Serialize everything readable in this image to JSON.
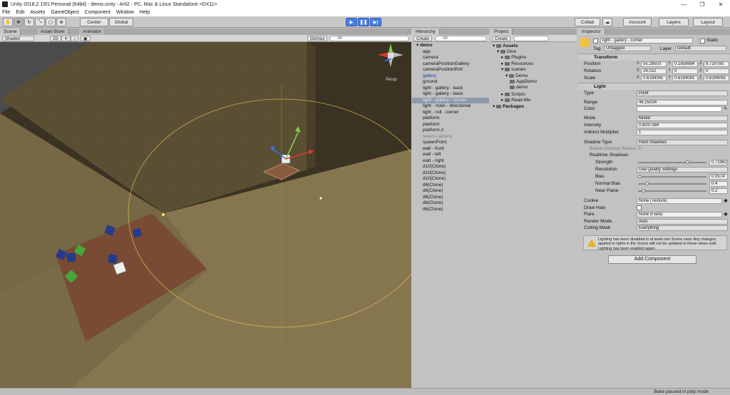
{
  "window": {
    "title": "Unity 2018.2.15f1 Personal (64bit) - demo.unity - Arti2 - PC, Mac & Linux Standalone <DX11>",
    "minimize": "—",
    "maximize": "❐",
    "close": "✕"
  },
  "menu": [
    "File",
    "Edit",
    "Assets",
    "GameObject",
    "Component",
    "Window",
    "Help"
  ],
  "toolbar": {
    "pivot": "Center",
    "space": "Global",
    "collab": "Collab",
    "account": "Account",
    "layers": "Layers",
    "layout": "Layout"
  },
  "tabs": {
    "scene": "Scene",
    "asset_store": "Asset Store",
    "animator": "Animator",
    "hierarchy": "Hierarchy",
    "project": "Project",
    "inspector": "Inspector"
  },
  "scene_bar": {
    "shading": "Shaded",
    "mode": "2D",
    "gizmos": "Gizmos",
    "search": "All"
  },
  "scene_view": {
    "persp": "Persp"
  },
  "hierarchy": {
    "create": "Create",
    "search": "All",
    "root": "demo",
    "items": [
      {
        "label": "app",
        "state": "normal"
      },
      {
        "label": "camera",
        "state": "normal"
      },
      {
        "label": "cameraPositionGallery",
        "state": "normal"
      },
      {
        "label": "cameraPositionRoll",
        "state": "normal"
      },
      {
        "label": "gallery",
        "state": "prefab"
      },
      {
        "label": "ground",
        "state": "normal"
      },
      {
        "label": "light - gallery - back",
        "state": "normal"
      },
      {
        "label": "light - gallery - back",
        "state": "normal"
      },
      {
        "label": "light - gallery - corner",
        "state": "selected"
      },
      {
        "label": "light - main - directional",
        "state": "normal"
      },
      {
        "label": "light - roll - corner",
        "state": "normal"
      },
      {
        "label": "platform",
        "state": "normal"
      },
      {
        "label": "platform",
        "state": "normal"
      },
      {
        "label": "platform-2",
        "state": "normal"
      },
      {
        "label": "select-camera",
        "state": "dim"
      },
      {
        "label": "spawnPoint",
        "state": "normal"
      },
      {
        "label": "wall - front",
        "state": "normal"
      },
      {
        "label": "wall - left",
        "state": "normal"
      },
      {
        "label": "wall - right",
        "state": "normal"
      },
      {
        "label": "d10(Clone)",
        "state": "normal"
      },
      {
        "label": "d10(Clone)",
        "state": "normal"
      },
      {
        "label": "d10(Clone)",
        "state": "normal"
      },
      {
        "label": "d6(Clone)",
        "state": "normal"
      },
      {
        "label": "d6(Clone)",
        "state": "normal"
      },
      {
        "label": "d6(Clone)",
        "state": "normal"
      },
      {
        "label": "d6(Clone)",
        "state": "normal"
      },
      {
        "label": "d6(Clone)",
        "state": "normal"
      }
    ]
  },
  "project": {
    "create": "Create",
    "tree": [
      {
        "label": "Assets",
        "level": 0,
        "bold": true
      },
      {
        "label": "Dice",
        "level": 1
      },
      {
        "label": "Plugins",
        "level": 2
      },
      {
        "label": "Resources",
        "level": 2
      },
      {
        "label": "scenes",
        "level": 2
      },
      {
        "label": "Demo",
        "level": 3
      },
      {
        "label": "AppDemo",
        "level": 4
      },
      {
        "label": "demo",
        "level": 4
      },
      {
        "label": "Scripts",
        "level": 2
      },
      {
        "label": "Read-Me-",
        "level": 2
      },
      {
        "label": "Packages",
        "level": 0,
        "bold": true
      }
    ]
  },
  "inspector": {
    "name": "light - gallery - corner",
    "static": "Static",
    "tag_label": "Tag",
    "tag": "Untagged",
    "layer_label": "Layer",
    "layer": "Default",
    "transform": {
      "title": "Transform",
      "position": {
        "label": "Position",
        "x": "55.28503",
        "y": "0.1859684",
        "z": "9.720785"
      },
      "rotation": {
        "label": "Rotation",
        "x": "24.012",
        "y": "0",
        "z": "0"
      },
      "scale": {
        "label": "Scale",
        "x": "0.6194091",
        "y": "0.6194091",
        "z": "0.6194091"
      }
    },
    "light": {
      "title": "Light",
      "type": {
        "label": "Type",
        "value": "Point"
      },
      "range": {
        "label": "Range",
        "value": "46.25034"
      },
      "color": {
        "label": "Color",
        "value": "#ffffff"
      },
      "mode": {
        "label": "Mode",
        "value": "Mixed"
      },
      "intensity": {
        "label": "Intensity",
        "value": "0.8037384"
      },
      "indirect": {
        "label": "Indirect Multiplier",
        "value": "1"
      },
      "shadow_type": {
        "label": "Shadow Type",
        "value": "Hard Shadows"
      },
      "baked_radius": {
        "label": "Baked Shadow Radius",
        "value": "0"
      },
      "realtime_shadows": "Realtime Shadows",
      "strength": {
        "label": "Strength",
        "value": "0.71962",
        "fraction": 0.72
      },
      "resolution": {
        "label": "Resolution",
        "value": "Use Quality Settings"
      },
      "bias": {
        "label": "Bias",
        "value": "0.0574",
        "fraction": 0.03
      },
      "normal_bias": {
        "label": "Normal Bias",
        "value": "0.4",
        "fraction": 0.13
      },
      "near_plane": {
        "label": "Near Plane",
        "value": "0.2",
        "fraction": 0.08
      },
      "cookie": {
        "label": "Cookie",
        "value": "None (Texture)"
      },
      "draw_halo": {
        "label": "Draw Halo"
      },
      "flare": {
        "label": "Flare",
        "value": "None (Flare)"
      },
      "render_mode": {
        "label": "Render Mode",
        "value": "Auto"
      },
      "culling_mask": {
        "label": "Culling Mask",
        "value": "Everything"
      }
    },
    "warning": "Lighting has been disabled in at least one Scene view. Any changes applied to lights in the Scene will not be updated in these views until Lighting has been enabled again.",
    "add_component": "Add Component"
  },
  "status": {
    "text": "Bake paused in play mode"
  }
}
